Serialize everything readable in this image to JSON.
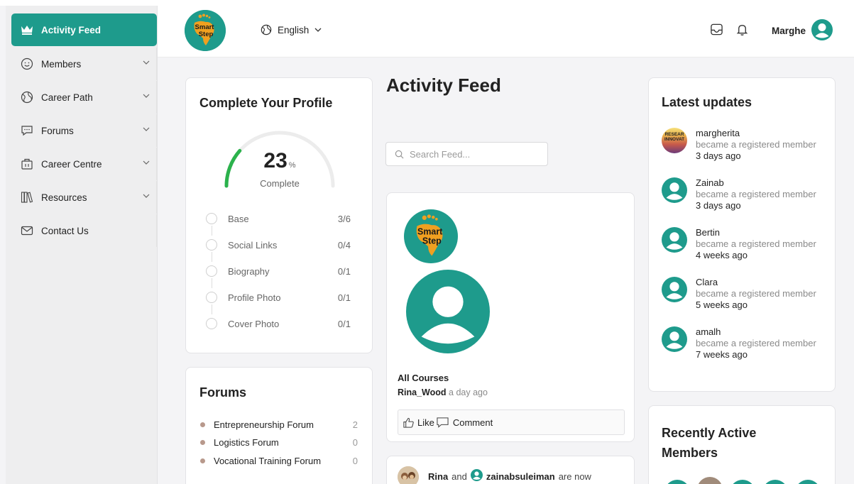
{
  "sidebar": {
    "items": [
      {
        "label": "Activity Feed",
        "icon": "crown-icon",
        "active": true
      },
      {
        "label": "Members",
        "icon": "smiley-icon"
      },
      {
        "label": "Career Path",
        "icon": "globe-icon"
      },
      {
        "label": "Forums",
        "icon": "chat-bubble-icon"
      },
      {
        "label": "Career Centre",
        "icon": "briefcase-icon"
      },
      {
        "label": "Resources",
        "icon": "books-icon"
      },
      {
        "label": "Contact Us",
        "icon": "envelope-icon"
      }
    ]
  },
  "header": {
    "logo_text_1": "Smart",
    "logo_text_2": "Step",
    "language": "English",
    "username": "Marghe"
  },
  "profile": {
    "title": "Complete Your Profile",
    "percent": "23",
    "percent_sign": "%",
    "progress_fraction": 0.23,
    "complete_label": "Complete",
    "steps": [
      {
        "label": "Base",
        "count": "3/6"
      },
      {
        "label": "Social Links",
        "count": "0/4"
      },
      {
        "label": "Biography",
        "count": "0/1"
      },
      {
        "label": "Profile Photo",
        "count": "0/1"
      },
      {
        "label": "Cover Photo",
        "count": "0/1"
      }
    ]
  },
  "forums": {
    "title": "Forums",
    "items": [
      {
        "label": "Entrepreneurship Forum",
        "count": "2"
      },
      {
        "label": "Logistics Forum",
        "count": "0"
      },
      {
        "label": "Vocational Training Forum",
        "count": "0"
      }
    ]
  },
  "feed": {
    "title": "Activity Feed",
    "search_placeholder": "Search Feed...",
    "post": {
      "logo_text_1": "Smart",
      "logo_text_2": "Step",
      "title": "All Courses",
      "author": "Rina_Wood",
      "time": "a day ago",
      "like_label": "Like",
      "comment_label": "Comment"
    },
    "post2": {
      "user1": "Rina",
      "connector": "and",
      "user2": "zainabsuleiman",
      "text": "are now"
    }
  },
  "updates": {
    "title": "Latest updates",
    "items": [
      {
        "name": "margherita",
        "action": "became a registered member",
        "time": "3 days ago",
        "avatar": "image"
      },
      {
        "name": "Zainab",
        "action": "became a registered member",
        "time": "3 days ago",
        "avatar": "default"
      },
      {
        "name": "Bertin",
        "action": "became a registered member",
        "time": "4 weeks ago",
        "avatar": "default"
      },
      {
        "name": "Clara",
        "action": "became a registered member",
        "time": "5 weeks ago",
        "avatar": "default"
      },
      {
        "name": "amalh",
        "action": "became a registered member",
        "time": "7 weeks ago",
        "avatar": "default"
      }
    ],
    "avatar_image_text_1": "RESEAR",
    "avatar_image_text_2": "INNOVAT"
  },
  "recent": {
    "title_line1": "Recently Active",
    "title_line2": "Members"
  },
  "colors": {
    "accent": "#1e9b8c",
    "progress": "#2bb24c",
    "logo_orange": "#f0a020"
  }
}
